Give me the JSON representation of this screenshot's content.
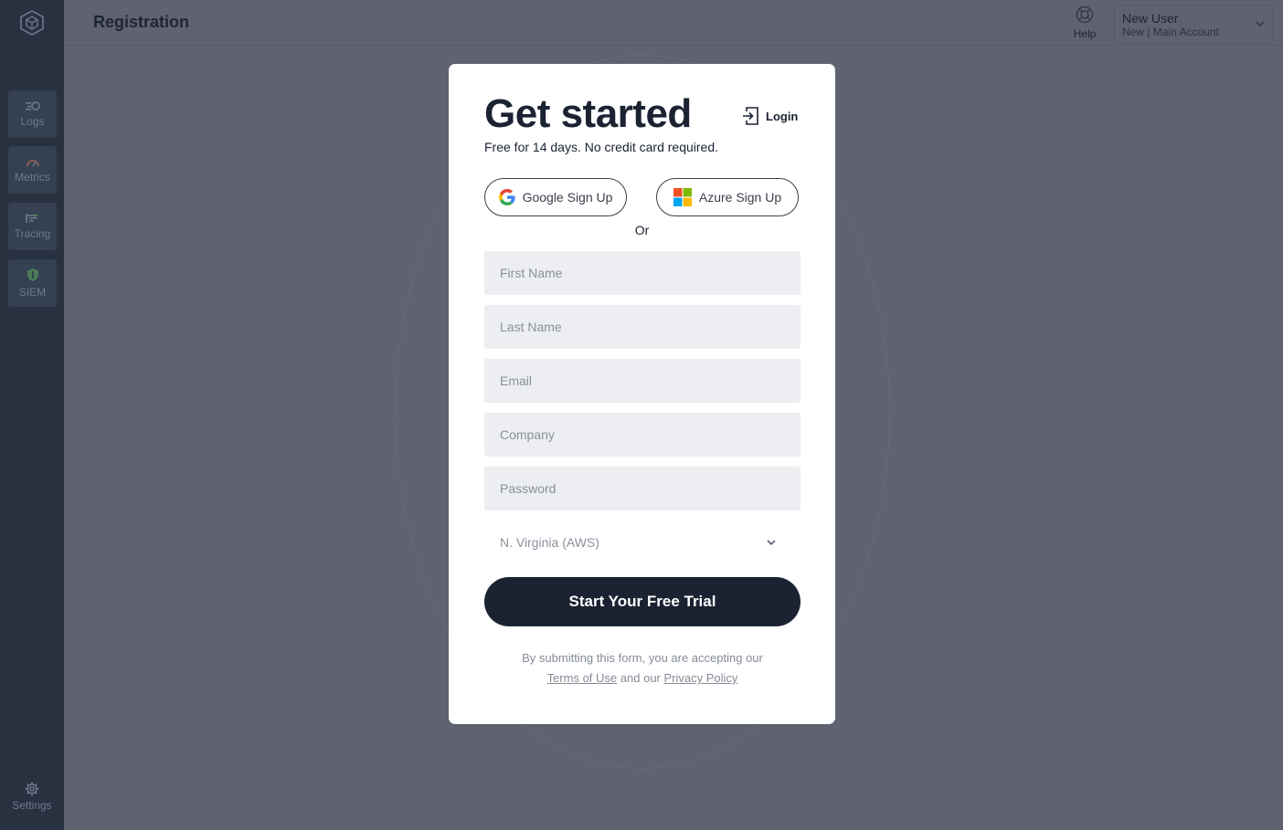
{
  "sidebar": {
    "logo": "cube-logo",
    "items": [
      {
        "label": "Logs",
        "icon": "logs-icon"
      },
      {
        "label": "Metrics",
        "icon": "gauge-icon"
      },
      {
        "label": "Tracing",
        "icon": "tracing-icon"
      },
      {
        "label": "SIEM",
        "icon": "shield-icon"
      }
    ],
    "settings_label": "Settings"
  },
  "header": {
    "title": "Registration",
    "help_label": "Help",
    "account": {
      "name": "New User",
      "sub": "New | Main Account"
    }
  },
  "modal": {
    "title": "Get started",
    "login_label": "Login",
    "subtitle": "Free for 14 days. No credit card required.",
    "google_label": "Google Sign Up",
    "azure_label": "Azure Sign Up",
    "or_label": "Or",
    "fields": {
      "first_name": "First Name",
      "last_name": "Last Name",
      "email": "Email",
      "company": "Company",
      "password": "Password"
    },
    "region_value": "N. Virginia (AWS)",
    "cta_label": "Start Your Free Trial",
    "legal": {
      "line1": "By submitting this form, you are accepting our",
      "terms": "Terms of Use",
      "and": "and our",
      "privacy": "Privacy Policy"
    }
  },
  "colors": {
    "overlay": "#5f6270",
    "sidebar": "#283140",
    "primary": "#1b2232",
    "field_bg": "#eceef1"
  }
}
